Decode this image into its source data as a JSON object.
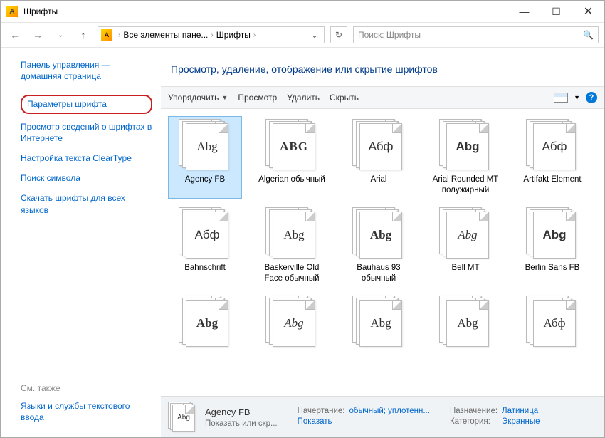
{
  "window": {
    "title": "Шрифты"
  },
  "nav": {
    "crumb1": "Все элементы пане...",
    "crumb2": "Шрифты",
    "search_placeholder": "Поиск: Шрифты"
  },
  "sidebar": {
    "home": "Панель управления — домашняя страница",
    "items": [
      "Параметры шрифта",
      "Просмотр сведений о шрифтах в Интернете",
      "Настройка текста ClearType",
      "Поиск символа",
      "Скачать шрифты для всех языков"
    ],
    "see_also_label": "См. также",
    "see_also_item": "Языки и службы текстового ввода"
  },
  "main": {
    "heading": "Просмотр, удаление, отображение или скрытие шрифтов",
    "toolbar": {
      "organize": "Упорядочить",
      "preview": "Просмотр",
      "delete": "Удалить",
      "hide": "Скрыть"
    }
  },
  "fonts": [
    {
      "sample": "Abg",
      "label": "Agency FB",
      "style": "font-family:Arial Narrow;"
    },
    {
      "sample": "ABG",
      "label": "Algerian обычный",
      "style": "font-family:serif;letter-spacing:1px;font-weight:bold;"
    },
    {
      "sample": "Абф",
      "label": "Arial",
      "style": "font-family:Arial;"
    },
    {
      "sample": "Abg",
      "label": "Arial Rounded MT полужирный",
      "style": "font-family:Arial;font-weight:bold;"
    },
    {
      "sample": "Абф",
      "label": "Artifakt Element",
      "style": "font-family:Arial;"
    },
    {
      "sample": "Абф",
      "label": "Bahnschrift",
      "style": "font-family:Arial;"
    },
    {
      "sample": "Abg",
      "label": "Baskerville Old Face обычный",
      "style": "font-family:Georgia;"
    },
    {
      "sample": "Abg",
      "label": "Bauhaus 93 обычный",
      "style": "font-family:Arial Black;font-weight:900;"
    },
    {
      "sample": "Abg",
      "label": "Bell MT",
      "style": "font-family:Georgia;font-style:italic;"
    },
    {
      "sample": "Abg",
      "label": "Berlin Sans FB",
      "style": "font-family:Arial;font-weight:bold;"
    },
    {
      "sample": "Abg",
      "label": "",
      "style": "font-family:Arial Black;font-weight:900;"
    },
    {
      "sample": "Abg",
      "label": "",
      "style": "font-family:cursive;font-style:italic;"
    },
    {
      "sample": "Abg",
      "label": "",
      "style": "font-family:Georgia;"
    },
    {
      "sample": "Abg",
      "label": "",
      "style": "font-family:Arial Narrow;"
    },
    {
      "sample": "Абф",
      "label": "",
      "style": "font-family:Georgia;"
    }
  ],
  "details": {
    "sample": "Abg",
    "name": "Agency FB",
    "row2_label": "Показать или скр...",
    "style_label": "Начертание:",
    "style_value": "обычный; уплотенн...",
    "show_value": "Показать",
    "designed_label": "Назначение:",
    "designed_value": "Латиница",
    "category_label": "Категория:",
    "category_value": "Экранные"
  }
}
